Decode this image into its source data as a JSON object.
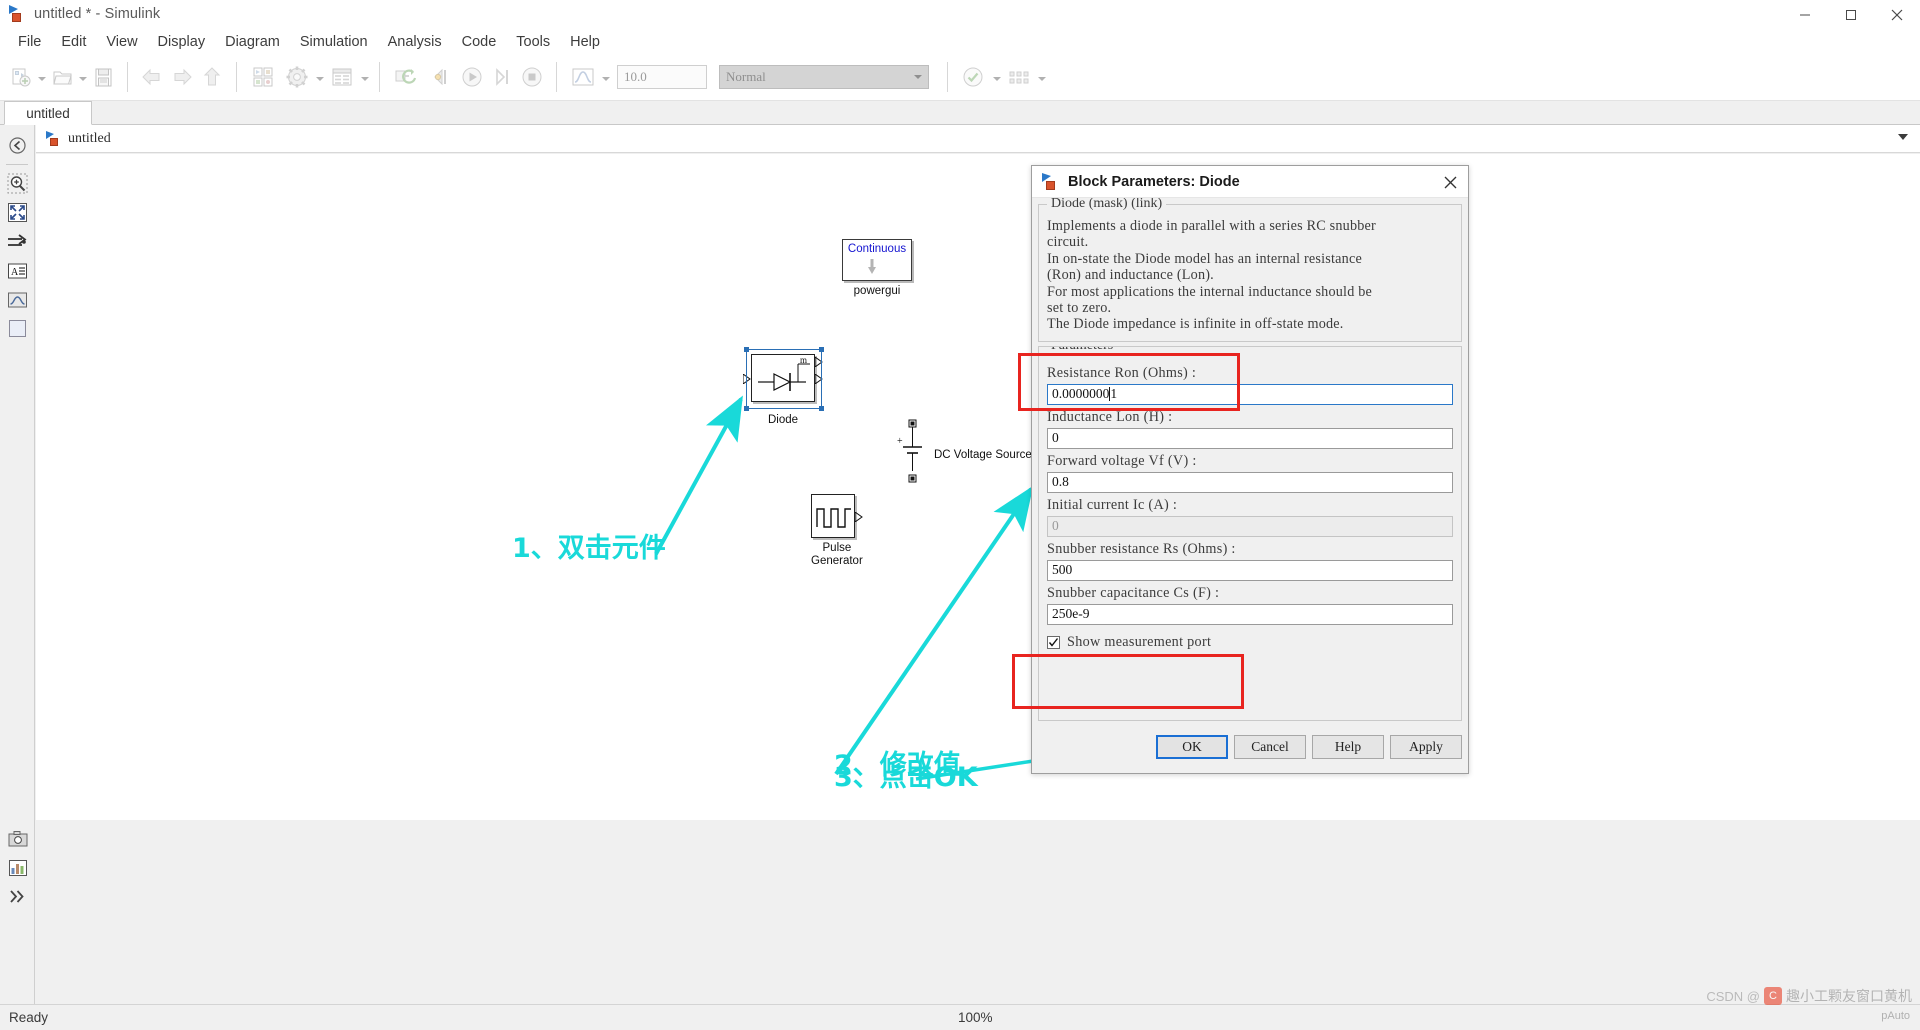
{
  "window": {
    "title": "untitled * - Simulink",
    "icon": "simulink-icon",
    "controls": {
      "minimize": "minimize-icon",
      "maximize": "maximize-icon",
      "close": "close-icon"
    }
  },
  "menubar": {
    "items": [
      "File",
      "Edit",
      "View",
      "Display",
      "Diagram",
      "Simulation",
      "Analysis",
      "Code",
      "Tools",
      "Help"
    ]
  },
  "toolbar": {
    "sim_time": "10.0",
    "sim_mode": "Normal",
    "icons": [
      "new-model-icon",
      "open-model-icon",
      "save-icon",
      "back-icon",
      "forward-icon",
      "up-icon",
      "library-browser-icon",
      "model-settings-icon",
      "model-explorer-icon",
      "update-model-icon",
      "step-back-icon",
      "run-icon",
      "step-forward-icon",
      "stop-icon",
      "scope-icon"
    ]
  },
  "tabs": {
    "active": "untitled"
  },
  "breadcrumb": {
    "label": "untitled",
    "icon": "simulink-model-icon"
  },
  "left_rail": {
    "items": [
      "back-to-parent-icon",
      "zoom-icon",
      "fit-to-view-icon",
      "signal-route-icon",
      "annotation-icon",
      "image-icon",
      "area-icon"
    ]
  },
  "bottom_rail": {
    "items": [
      "camera-icon",
      "data-inspector-icon",
      "expand-icon"
    ]
  },
  "canvas": {
    "blocks": [
      {
        "name": "powergui",
        "inner_label": "Continuous",
        "caption": "powergui"
      },
      {
        "name": "diode",
        "caption": "Diode",
        "port_label": "m",
        "selected": true
      },
      {
        "name": "dc-voltage-source",
        "caption": "DC Voltage Source",
        "polarity": "+"
      },
      {
        "name": "pulse-generator",
        "caption": "Pulse\nGenerator"
      }
    ],
    "annotations": [
      {
        "id": "step1",
        "text": "1、双击元件"
      },
      {
        "id": "step2",
        "text": "2、修改值"
      },
      {
        "id": "step3",
        "text": "3、点击OK"
      }
    ],
    "accent_color": "#19d9d9",
    "highlight_color": "#e8241f"
  },
  "dialog": {
    "title": "Block Parameters: Diode",
    "close_label": "×",
    "description_group": {
      "legend": "Diode (mask) (link)",
      "text": "Implements a diode in parallel with a series RC snubber\ncircuit.\nIn on-state the Diode model has an internal resistance\n(Ron) and inductance (Lon).\nFor most applications the internal inductance should be\nset to zero.\nThe Diode impedance is infinite in off-state mode."
    },
    "parameters_group": {
      "legend": "Parameters",
      "fields": [
        {
          "label": "Resistance Ron (Ohms) :",
          "value": "0.0000000",
          "trailing": "1",
          "focused": true,
          "disabled": false,
          "highlighted": true
        },
        {
          "label": "Inductance Lon (H) :",
          "value": "0",
          "focused": false,
          "disabled": false
        },
        {
          "label": "Forward voltage Vf (V) :",
          "value": "0.8",
          "focused": false,
          "disabled": false
        },
        {
          "label": "Initial current Ic (A) :",
          "value": "0",
          "focused": false,
          "disabled": true
        },
        {
          "label": "Snubber resistance Rs (Ohms) :",
          "value": "500",
          "focused": false,
          "disabled": false
        },
        {
          "label": "Snubber capacitance Cs (F) :",
          "value": "250e-9",
          "focused": false,
          "disabled": false
        }
      ],
      "checkbox": {
        "label": "Show measurement port",
        "checked": true,
        "highlighted": true
      }
    },
    "buttons": [
      {
        "label": "OK",
        "primary": true
      },
      {
        "label": "Cancel",
        "primary": false
      },
      {
        "label": "Help",
        "primary": false
      },
      {
        "label": "Apply",
        "primary": false
      }
    ]
  },
  "statusbar": {
    "status": "Ready",
    "zoom": "100%"
  },
  "watermark": {
    "text": "CSDN @",
    "cn": "趣小工颗友窗口黄机",
    "sub": "pAuto"
  }
}
